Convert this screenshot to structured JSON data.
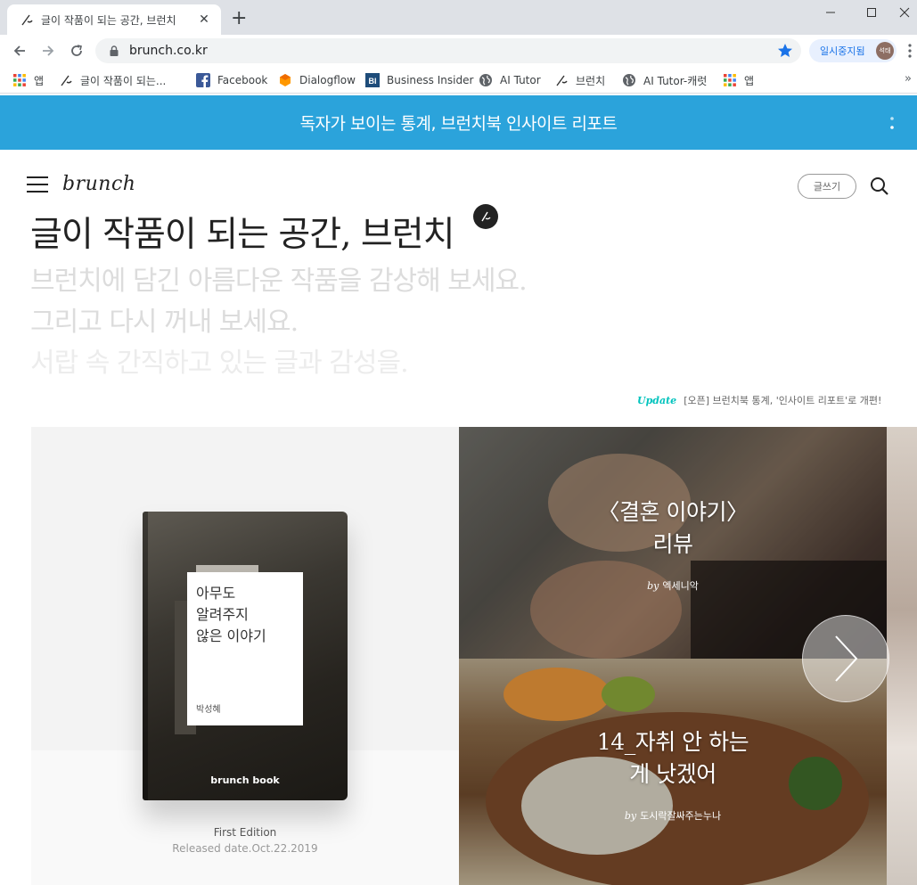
{
  "browser": {
    "tab_title": "글이 작품이 되는 공간, 브런치",
    "tab_close": "✕",
    "new_tab": "+",
    "url": "brunch.co.kr",
    "profile_name": "일시중지됨",
    "profile_avatar": "석태",
    "bookmarks": [
      {
        "label": "앱",
        "icon": "apps-grid-icon"
      },
      {
        "label": "글이 작품이 되는...",
        "icon": "brunch-pen-icon"
      },
      {
        "label": "Facebook",
        "icon": "facebook-icon"
      },
      {
        "label": "Dialogflow",
        "icon": "dialogflow-icon"
      },
      {
        "label": "Business Insider",
        "icon": "business-insider-icon"
      },
      {
        "label": "AI Tutor",
        "icon": "globe-icon"
      },
      {
        "label": "브런치",
        "icon": "brunch-pen-icon"
      },
      {
        "label": "AI Tutor-캐럿",
        "icon": "globe-icon"
      },
      {
        "label": "앱",
        "icon": "apps-grid-icon"
      }
    ],
    "bookmarks_more": "»"
  },
  "banner": {
    "text": "독자가 보이는 통계, 브런치북 인사이트 리포트"
  },
  "header": {
    "logo": "brunch",
    "write_label": "글쓰기"
  },
  "hero": {
    "title": "글이 작품이 되는 공간, 브런치",
    "lines": [
      "브런치에 담긴 아름다운 작품을 감상해 보세요.",
      "그리고 다시 꺼내 보세요.",
      "서랍 속 간직하고 있는 글과 감성을."
    ]
  },
  "update": {
    "tag": "Update",
    "text": "[오픈] 브런치북 통계, '인사이트 리포트'로 개편!"
  },
  "book": {
    "title_lines": [
      "아무도",
      "알려주지",
      "않은 이야기"
    ],
    "author": "박성혜",
    "brand": "brunch book",
    "edition": "First Edition",
    "release": "Released date.Oct.22.2019"
  },
  "cards": [
    {
      "title_lines": [
        "〈결혼 이야기〉",
        "리뷰"
      ],
      "by": "by",
      "author": "엑세니악"
    },
    {
      "title_lines": [
        "14_자취 안 하는",
        "게 낫겠어"
      ],
      "by": "by",
      "author": "도시락잘싸주는누나"
    }
  ],
  "colors": {
    "banner": "#2ba3db",
    "update_tag": "#00c3bd",
    "hero_sub": "#dcdcdc"
  }
}
